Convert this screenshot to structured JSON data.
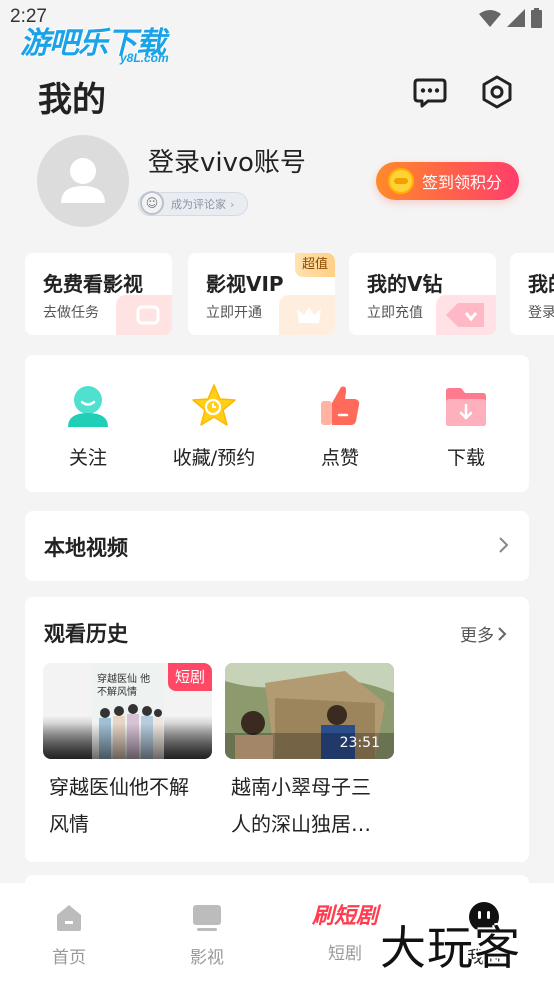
{
  "status_bar": {
    "time": "2:27"
  },
  "watermark": {
    "logo_text": "游吧乐下载",
    "logo_sub": "y8L.com",
    "bottom_text": "大玩客"
  },
  "header": {
    "title": "我的"
  },
  "profile": {
    "login_text": "登录vivo账号",
    "badge_label": "成为评论家",
    "checkin_label": "签到领积分"
  },
  "promos": [
    {
      "title": "免费看影视",
      "subtitle": "去做任务"
    },
    {
      "title": "影视VIP",
      "subtitle": "立即开通",
      "tag": "超值"
    },
    {
      "title": "我的V钻",
      "subtitle": "立即充值"
    },
    {
      "title": "我的",
      "subtitle": "登录"
    }
  ],
  "quick_actions": [
    {
      "label": "关注",
      "icon": "follow-icon"
    },
    {
      "label": "收藏/预约",
      "icon": "favorite-star-icon"
    },
    {
      "label": "点赞",
      "icon": "like-thumb-icon"
    },
    {
      "label": "下载",
      "icon": "download-folder-icon"
    }
  ],
  "local_video": {
    "label": "本地视频"
  },
  "history": {
    "title": "观看历史",
    "more_label": "更多",
    "items": [
      {
        "title": "穿越医仙他不解风情",
        "tag": "短剧",
        "poster_text": "穿越医仙 他不解风情"
      },
      {
        "title": "越南小翠母子三人的深山独居…",
        "duration": "23:51"
      }
    ]
  },
  "bottom_nav": [
    {
      "label": "首页",
      "icon": "home-icon"
    },
    {
      "label": "影视",
      "icon": "tv-icon"
    },
    {
      "label": "短剧",
      "logo": "刷短剧"
    },
    {
      "label": "我的",
      "icon": "profile-face-icon"
    }
  ],
  "colors": {
    "accent_orange": "#ff8a2a",
    "accent_pink": "#ff3d6b",
    "short_tag": "#ff4866",
    "background": "#f4f4f4"
  }
}
